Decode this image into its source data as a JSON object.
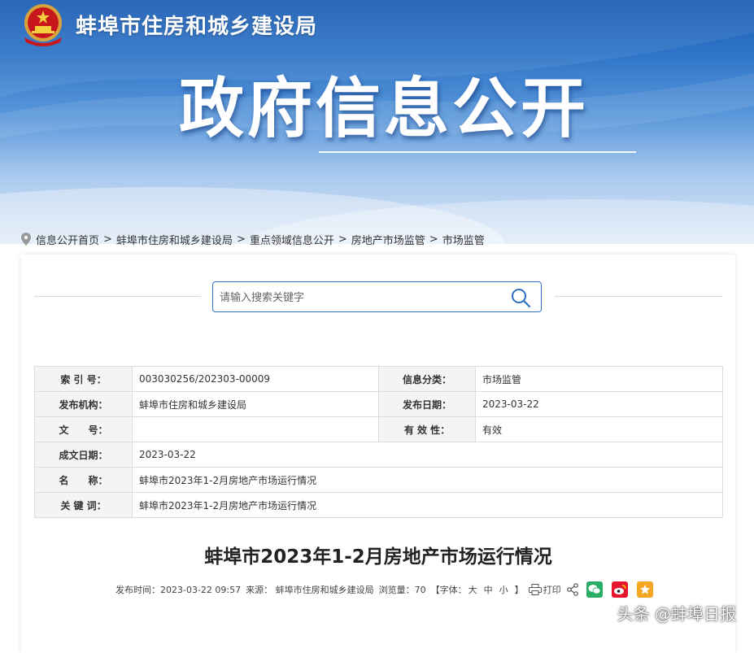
{
  "site": {
    "name": "蚌埠市住房和城乡建设局"
  },
  "banner": {
    "title": "政府信息公开"
  },
  "breadcrumb": [
    "信息公开首页",
    "蚌埠市住房和城乡建设局",
    "重点领域信息公开",
    "房地产市场监管",
    "市场监管"
  ],
  "search": {
    "placeholder": "请输入搜索关键字"
  },
  "meta": {
    "index_label": "索 引 号：",
    "index_value": "003030256/202303-00009",
    "category_label": "信息分类：",
    "category_value": "市场监管",
    "publisher_label": "发布机构：",
    "publisher_value": "蚌埠市住房和城乡建设局",
    "publish_date_label": "发布日期：",
    "publish_date_value": "2023-03-22",
    "doc_no_label": "文　　号：",
    "doc_no_value": "",
    "validity_label": "有 效 性：",
    "validity_value": "有效",
    "written_date_label": "成文日期：",
    "written_date_value": "2023-03-22",
    "name_label": "名　　称：",
    "name_value": "蚌埠市2023年1-2月房地产市场运行情况",
    "keywords_label": "关 键 词：",
    "keywords_value": "蚌埠市2023年1-2月房地产市场运行情况"
  },
  "article": {
    "title": "蚌埠市2023年1-2月房地产市场运行情况",
    "published": "发布时间：2023-03-22 09:57",
    "source": "来源： 蚌埠市住房和城乡建设局",
    "views": "浏览量：70",
    "font_size_prefix": "【字体：",
    "font_large": "大",
    "font_medium": "中",
    "font_small": "小",
    "font_size_suffix": "】",
    "print": "打印"
  },
  "watermark": "头条 @蚌埠日报",
  "colors": {
    "accent": "#2f6fc1",
    "wechat": "#2aae67",
    "weibo": "#e6162d",
    "favorite": "#f5a623"
  }
}
